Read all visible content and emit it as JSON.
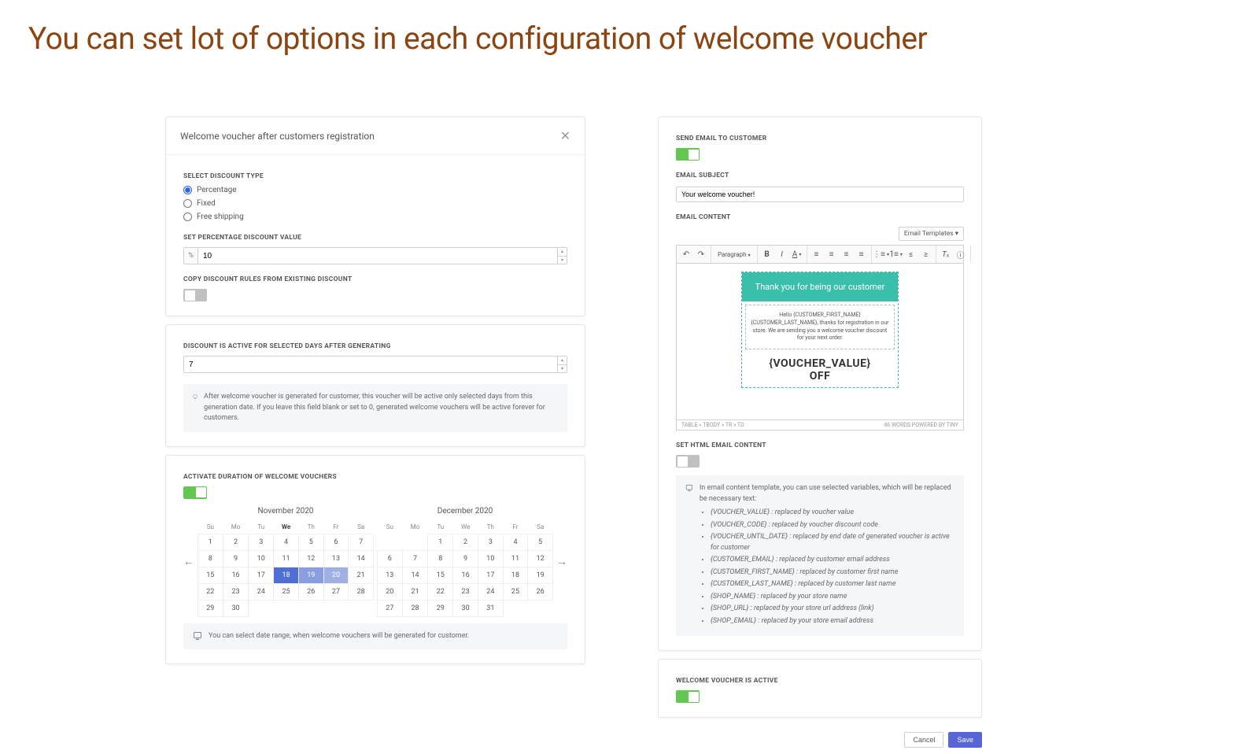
{
  "page_title": "You can set lot of options in each configuration of welcome voucher",
  "left": {
    "header": "Welcome voucher after customers registration",
    "discount_type": {
      "label": "SELECT DISCOUNT TYPE",
      "options": [
        "Percentage",
        "Fixed",
        "Free shipping"
      ],
      "selected": "Percentage"
    },
    "percentage": {
      "label": "SET PERCENTAGE DISCOUNT VALUE",
      "prefix": "%",
      "value": "10"
    },
    "copy_rules_label": "COPY DISCOUNT RULES FROM EXISTING DISCOUNT",
    "active_days": {
      "label": "DISCOUNT IS ACTIVE FOR SELECTED DAYS AFTER GENERATING",
      "value": "7",
      "info": "After welcome voucher is generated for customer, this voucher will be active only selected days from this generation date. If you leave this field blank or set to 0, generated welcome vouchers will be active forever for customers."
    },
    "activate_duration_label": "ACTIVATE DURATION OF WELCOME VOUCHERS",
    "cal1": {
      "title": "November 2020",
      "days": [
        "Su",
        "Mo",
        "Tu",
        "We",
        "Th",
        "Fr",
        "Sa"
      ],
      "rows": [
        [
          1,
          2,
          3,
          4,
          5,
          6,
          7
        ],
        [
          8,
          9,
          10,
          11,
          12,
          13,
          14
        ],
        [
          15,
          16,
          17,
          18,
          19,
          20,
          21
        ],
        [
          22,
          23,
          24,
          25,
          26,
          27,
          28
        ],
        [
          29,
          30,
          "",
          "",
          "",
          "",
          ""
        ]
      ],
      "selected": [
        18,
        19,
        20
      ]
    },
    "cal2": {
      "title": "December 2020",
      "days": [
        "Su",
        "Mo",
        "Tu",
        "We",
        "Th",
        "Fr",
        "Sa"
      ],
      "rows": [
        [
          "",
          "",
          1,
          2,
          3,
          4,
          5
        ],
        [
          6,
          7,
          8,
          9,
          10,
          11,
          12
        ],
        [
          13,
          14,
          15,
          16,
          17,
          18,
          19
        ],
        [
          20,
          21,
          22,
          23,
          24,
          25,
          26
        ],
        [
          27,
          28,
          29,
          30,
          31,
          "",
          ""
        ]
      ]
    },
    "date_range_info": "You can select date range, when welcome vouchers will be generated for customer."
  },
  "right": {
    "send_email_label": "SEND EMAIL TO CUSTOMER",
    "email_subject_label": "EMAIL SUBJECT",
    "email_subject_value": "Your welcome voucher!",
    "email_content_label": "EMAIL CONTENT",
    "email_templates_btn": "Email Templates",
    "paragraph_label": "Paragraph",
    "editor_hero": "Thank you for being our customer",
    "editor_body": "Hello {CUSTOMER_FIRST_NAME} {CUSTOMER_LAST_NAME}, thanks for registration in our store. We are sending you a welcome voucher discount for your next order.",
    "editor_voucher_1": "{VOUCHER_VALUE}",
    "editor_voucher_2": "OFF",
    "editor_path": "TABLE » TBODY » TR » TD",
    "editor_words": "46 WORDS  POWERED BY TINY",
    "set_html_label": "SET HTML EMAIL CONTENT",
    "variables_intro": "In email content template, you can use selected variables, which will be replaced be necessary text:",
    "variables": [
      "{VOUCHER_VALUE} : replaced by voucher value",
      "{VOUCHER_CODE} : replaced by voucher discount code",
      "{VOUCHER_UNTIL_DATE} : replaced by end date of generated voucher is active for customer",
      "{CUSTOMER_EMAIL} : replaced by customer email address",
      "{CUSTOMER_FIRST_NAME} : replaced by customer first name",
      "{CUSTOMER_LAST_NAME} : replaced by customer last name",
      "{SHOP_NAME} : replaced by your store name",
      "{SHOP_URL} : replaced by your store url address (link)",
      "{SHOP_EMAIL} : replaced by your store email address"
    ],
    "voucher_active_label": "WELCOME VOUCHER IS ACTIVE",
    "cancel": "Cancel",
    "save": "Save"
  }
}
